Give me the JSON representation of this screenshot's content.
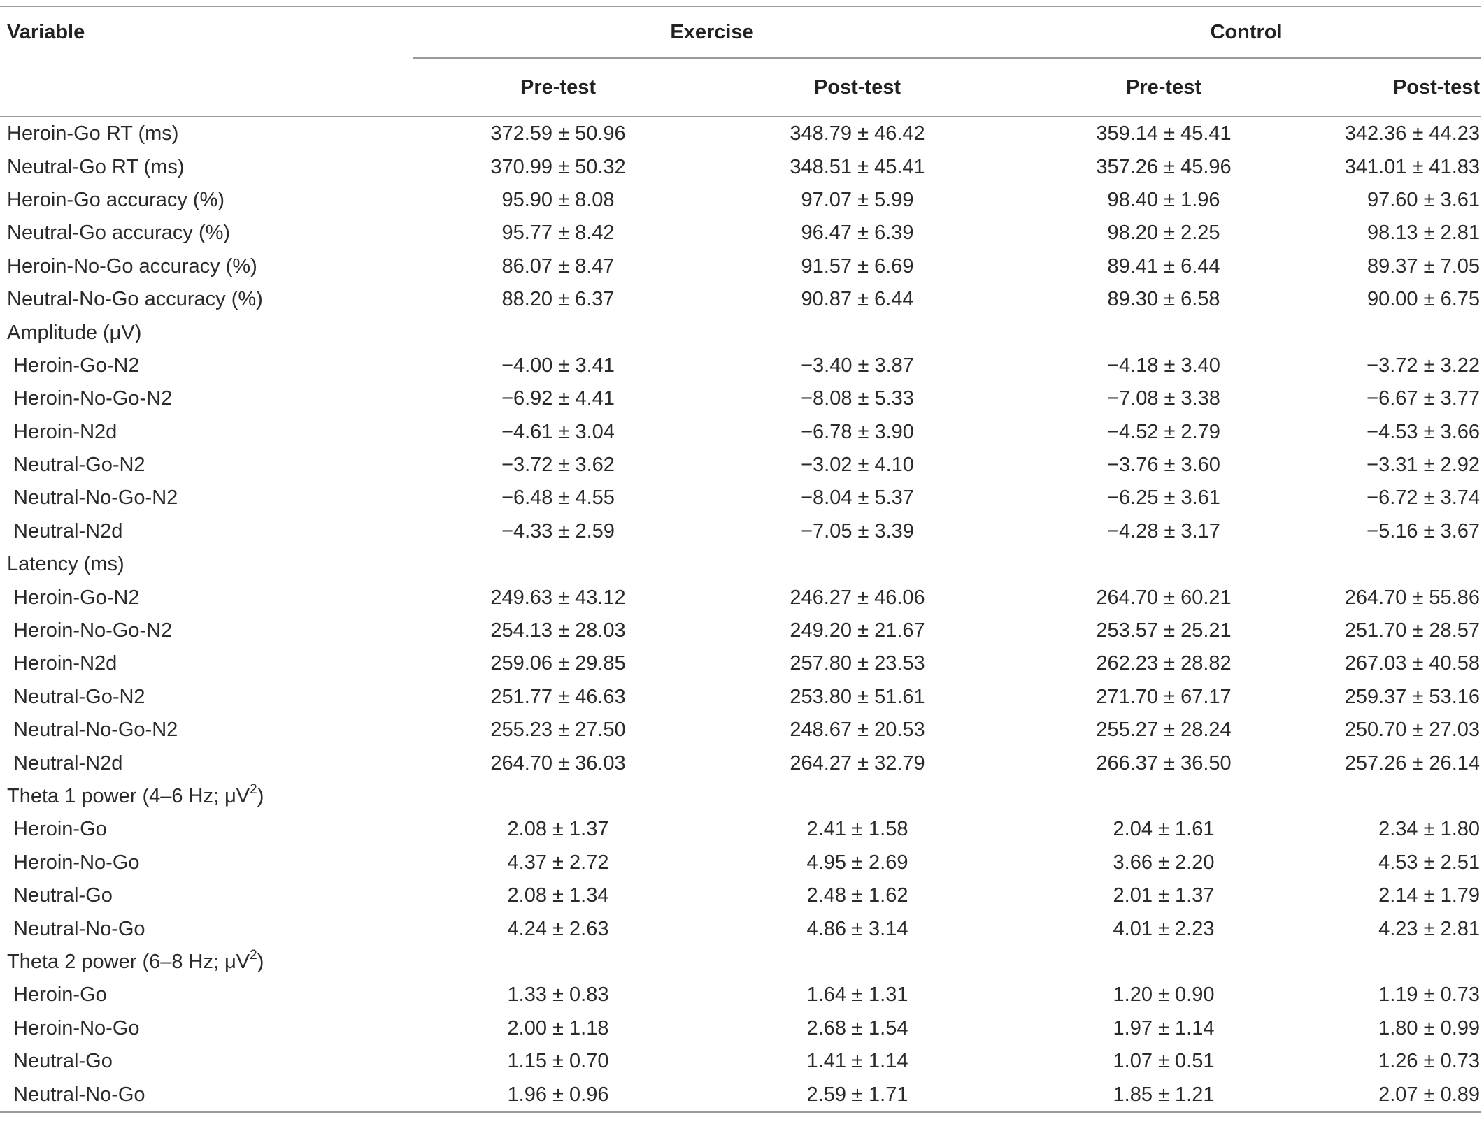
{
  "table": {
    "header": {
      "variable": "Variable",
      "groups": [
        {
          "name": "Exercise"
        },
        {
          "name": "Control"
        }
      ],
      "columns": [
        "Pre-test",
        "Post-test",
        "Pre-test",
        "Post-test"
      ]
    },
    "rows": [
      {
        "type": "data",
        "label": "Heroin-Go RT (ms)",
        "values": [
          "372.59 ± 50.96",
          "348.79 ± 46.42",
          "359.14 ± 45.41",
          "342.36 ± 44.23"
        ]
      },
      {
        "type": "data",
        "label": "Neutral-Go RT (ms)",
        "values": [
          "370.99 ± 50.32",
          "348.51 ± 45.41",
          "357.26 ± 45.96",
          "341.01 ± 41.83"
        ]
      },
      {
        "type": "data",
        "label": "Heroin-Go accuracy (%)",
        "values": [
          "95.90 ± 8.08",
          "97.07 ± 5.99",
          "98.40 ± 1.96",
          "97.60 ± 3.61"
        ]
      },
      {
        "type": "data",
        "label": "Neutral-Go accuracy (%)",
        "values": [
          "95.77 ± 8.42",
          "96.47 ± 6.39",
          "98.20 ± 2.25",
          "98.13 ± 2.81"
        ]
      },
      {
        "type": "data",
        "label": "Heroin-No-Go accuracy (%)",
        "values": [
          "86.07 ± 8.47",
          "91.57 ± 6.69",
          "89.41 ± 6.44",
          "89.37 ± 7.05"
        ]
      },
      {
        "type": "data",
        "label": "Neutral-No-Go accuracy (%)",
        "values": [
          "88.20 ± 6.37",
          "90.87 ± 6.44",
          "89.30 ± 6.58",
          "90.00 ± 6.75"
        ]
      },
      {
        "type": "section",
        "label": "Amplitude (μV)"
      },
      {
        "type": "sub",
        "label": "Heroin-Go-N2",
        "values": [
          "−4.00 ± 3.41",
          "−3.40 ± 3.87",
          "−4.18 ± 3.40",
          "−3.72 ± 3.22"
        ]
      },
      {
        "type": "sub",
        "label": "Heroin-No-Go-N2",
        "values": [
          "−6.92 ± 4.41",
          "−8.08 ± 5.33",
          "−7.08 ± 3.38",
          "−6.67 ± 3.77"
        ]
      },
      {
        "type": "sub",
        "label": "Heroin-N2d",
        "values": [
          "−4.61 ± 3.04",
          "−6.78 ± 3.90",
          "−4.52 ± 2.79",
          "−4.53 ± 3.66"
        ]
      },
      {
        "type": "sub",
        "label": "Neutral-Go-N2",
        "values": [
          "−3.72 ± 3.62",
          "−3.02 ± 4.10",
          "−3.76 ± 3.60",
          "−3.31 ± 2.92"
        ]
      },
      {
        "type": "sub",
        "label": "Neutral-No-Go-N2",
        "values": [
          "−6.48 ± 4.55",
          "−8.04 ± 5.37",
          "−6.25 ± 3.61",
          "−6.72 ± 3.74"
        ]
      },
      {
        "type": "sub",
        "label": "Neutral-N2d",
        "values": [
          "−4.33 ± 2.59",
          "−7.05 ± 3.39",
          "−4.28 ± 3.17",
          "−5.16 ± 3.67"
        ]
      },
      {
        "type": "section",
        "label": "Latency (ms)"
      },
      {
        "type": "sub",
        "label": "Heroin-Go-N2",
        "values": [
          "249.63 ± 43.12",
          "246.27 ± 46.06",
          "264.70 ± 60.21",
          "264.70 ± 55.86"
        ]
      },
      {
        "type": "sub",
        "label": "Heroin-No-Go-N2",
        "values": [
          "254.13 ± 28.03",
          "249.20 ± 21.67",
          "253.57 ± 25.21",
          "251.70 ± 28.57"
        ]
      },
      {
        "type": "sub",
        "label": "Heroin-N2d",
        "values": [
          "259.06 ± 29.85",
          "257.80 ± 23.53",
          "262.23 ± 28.82",
          "267.03 ± 40.58"
        ]
      },
      {
        "type": "sub",
        "label": "Neutral-Go-N2",
        "values": [
          "251.77 ± 46.63",
          "253.80 ± 51.61",
          "271.70 ± 67.17",
          "259.37 ± 53.16"
        ]
      },
      {
        "type": "sub",
        "label": "Neutral-No-Go-N2",
        "values": [
          "255.23 ± 27.50",
          "248.67 ± 20.53",
          "255.27 ± 28.24",
          "250.70 ± 27.03"
        ]
      },
      {
        "type": "sub",
        "label": "Neutral-N2d",
        "values": [
          "264.70 ± 36.03",
          "264.27 ± 32.79",
          "266.37 ± 36.50",
          "257.26 ± 26.14"
        ]
      },
      {
        "type": "section",
        "label": "Theta 1 power (4–6 Hz; μV",
        "sup": "2",
        "suffix": ")"
      },
      {
        "type": "sub",
        "label": "Heroin-Go",
        "values": [
          "2.08 ± 1.37",
          "2.41 ± 1.58",
          "2.04 ± 1.61",
          "2.34 ± 1.80"
        ]
      },
      {
        "type": "sub",
        "label": "Heroin-No-Go",
        "values": [
          "4.37 ± 2.72",
          "4.95 ± 2.69",
          "3.66 ± 2.20",
          "4.53 ± 2.51"
        ]
      },
      {
        "type": "sub",
        "label": "Neutral-Go",
        "values": [
          "2.08 ± 1.34",
          "2.48 ± 1.62",
          "2.01 ± 1.37",
          "2.14 ± 1.79"
        ]
      },
      {
        "type": "sub",
        "label": "Neutral-No-Go",
        "values": [
          "4.24 ± 2.63",
          "4.86 ± 3.14",
          "4.01 ± 2.23",
          "4.23 ± 2.81"
        ]
      },
      {
        "type": "section",
        "label": "Theta 2 power (6–8 Hz; μV",
        "sup": "2",
        "suffix": ")"
      },
      {
        "type": "sub",
        "label": "Heroin-Go",
        "values": [
          "1.33 ± 0.83",
          "1.64 ± 1.31",
          "1.20 ± 0.90",
          "1.19 ± 0.73"
        ]
      },
      {
        "type": "sub",
        "label": "Heroin-No-Go",
        "values": [
          "2.00 ± 1.18",
          "2.68 ± 1.54",
          "1.97 ± 1.14",
          "1.80 ± 0.99"
        ]
      },
      {
        "type": "sub",
        "label": "Neutral-Go",
        "values": [
          "1.15 ± 0.70",
          "1.41 ± 1.14",
          "1.07 ± 0.51",
          "1.26 ± 0.73"
        ]
      },
      {
        "type": "sub",
        "label": "Neutral-No-Go",
        "values": [
          "1.96 ± 0.96",
          "2.59 ± 1.71",
          "1.85 ± 1.21",
          "2.07 ± 0.89"
        ]
      }
    ]
  }
}
